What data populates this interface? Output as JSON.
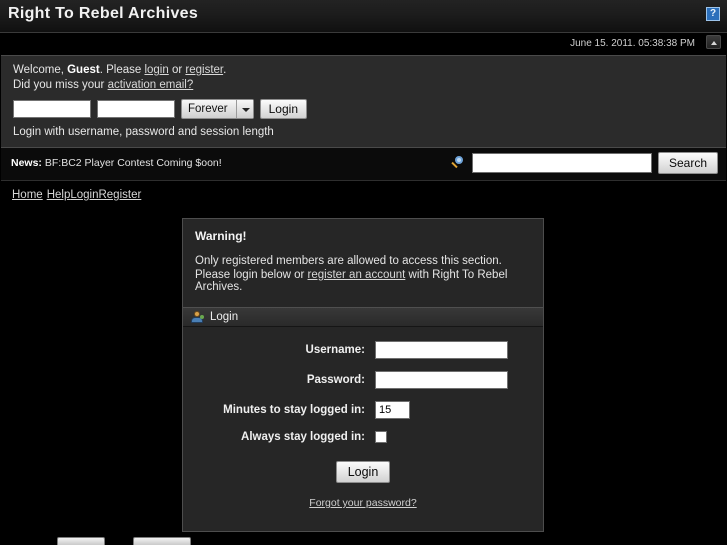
{
  "header": {
    "site_title": "Right To Rebel Archives",
    "help_icon_label": "?",
    "datetime": "June 15. 2011. 05:38:38 PM"
  },
  "welcome": {
    "greeting_prefix": "Welcome, ",
    "user_name": "Guest",
    "greeting_mid": ". Please ",
    "login_link": "login",
    "or_text": " or ",
    "register_link": "register",
    "greeting_suffix": ".",
    "activation_prefix": "Did you miss your ",
    "activation_link": "activation email?",
    "username_placeholder": "",
    "password_placeholder": "",
    "session_length": "Forever",
    "login_button": "Login",
    "hint": "Login with username, password and session length"
  },
  "newsbar": {
    "news_label": "News:",
    "news_text": " BF:BC2 Player Contest Coming $oon!",
    "search_placeholder": "",
    "search_button": "Search"
  },
  "nav": {
    "items": [
      {
        "label": "Home"
      },
      {
        "label": "Help"
      },
      {
        "label": "Login"
      },
      {
        "label": "Register"
      }
    ]
  },
  "content": {
    "warning_title": "Warning!",
    "warning_line1": "Only registered members are allowed to access this section.",
    "warning_line2_prefix": "Please login below or ",
    "warning_link": "register an account",
    "warning_line2_suffix": " with Right To Rebel Archives.",
    "panel_title": "Login",
    "fields": {
      "username_label": "Username:",
      "username_value": "",
      "password_label": "Password:",
      "password_value": "",
      "minutes_label": "Minutes to stay logged in:",
      "minutes_value": "15",
      "always_label": "Always stay logged in:",
      "always_checked": false
    },
    "submit_label": "Login",
    "forgot_link": "Forgot your password?"
  },
  "colors": {
    "page_background": "#000000",
    "panel_background": "#2b2b2b",
    "content_background": "#262626",
    "accent_blue": "#2b6fbb",
    "text_primary": "#f2f2f2",
    "link": "#d8d8d8"
  }
}
